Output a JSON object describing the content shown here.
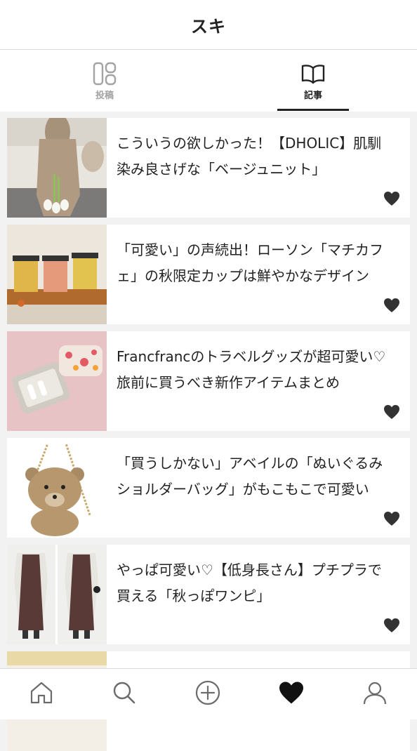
{
  "header": {
    "title": "スキ"
  },
  "tabs": [
    {
      "label": "投稿",
      "icon": "grid-icon",
      "active": false
    },
    {
      "label": "記事",
      "icon": "book-icon",
      "active": true
    }
  ],
  "articles": [
    {
      "title": "こういうの欲しかった！【DHOLIC】肌馴染み良さげな「ベージュニット」",
      "liked": true
    },
    {
      "title": "「可愛い」の声続出！ローソン「マチカフェ」の秋限定カップは鮮やかなデザイン",
      "liked": true
    },
    {
      "title": "Francfrancのトラベルグッズが超可愛い♡旅前に買うべき新作アイテムまとめ",
      "liked": true
    },
    {
      "title": "「買うしかない」アベイルの「ぬいぐるみショルダーバッグ」がもこもこで可愛い",
      "liked": true
    },
    {
      "title": "やっぱ可愛い♡【低身長さん】プチプラで買える「秋っぽワンピ」",
      "liked": true
    }
  ],
  "bottom_nav": [
    {
      "icon": "home-icon",
      "active": false
    },
    {
      "icon": "search-icon",
      "active": false
    },
    {
      "icon": "plus-circle-icon",
      "active": false
    },
    {
      "icon": "heart-icon",
      "active": true
    },
    {
      "icon": "profile-icon",
      "active": false
    }
  ],
  "colors": {
    "text": "#222222",
    "inactive": "#a3a3a3",
    "background": "#f2f2f2",
    "like": "#333333"
  }
}
